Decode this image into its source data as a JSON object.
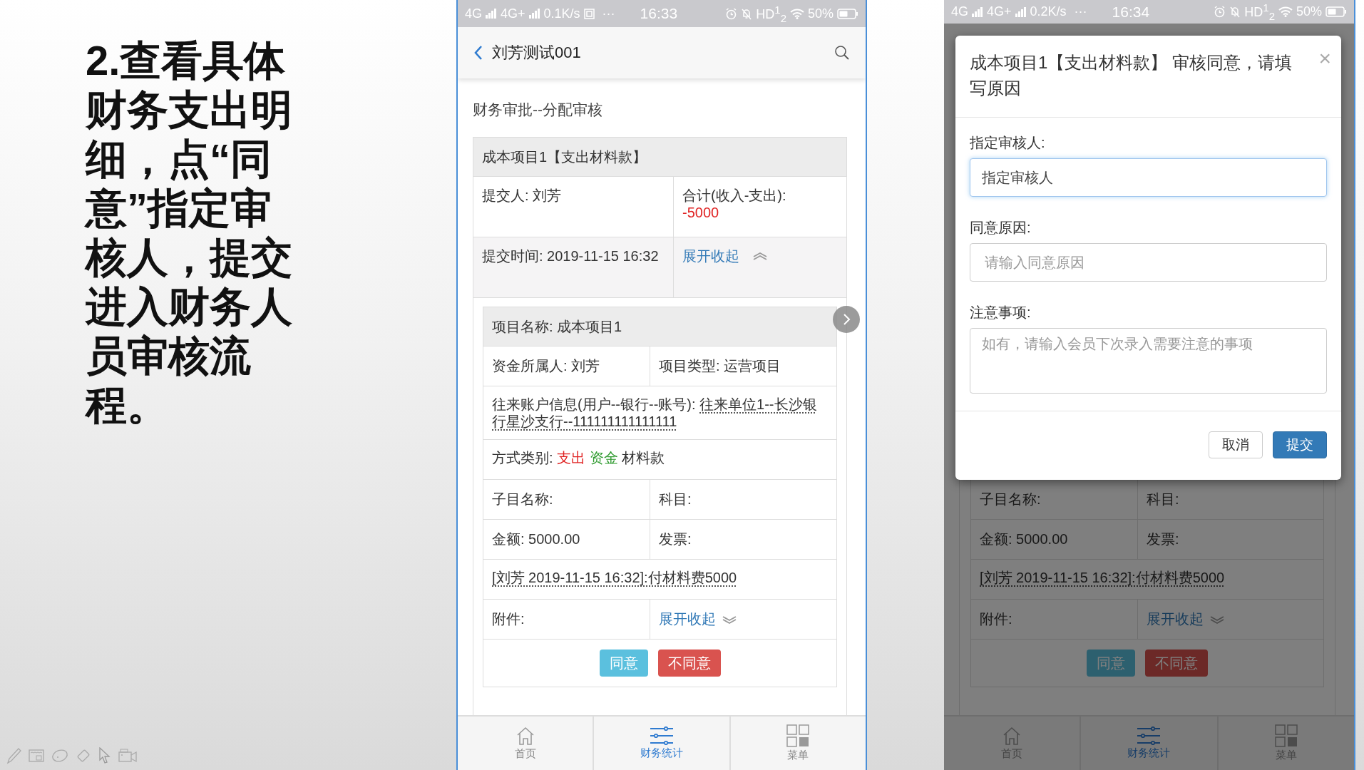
{
  "slide": {
    "instruction": "2.查看具体财务支出明细，点“同意”指定审核人，提交进入财务人员审核流程。"
  },
  "detail_screen": {
    "status_bar": {
      "network": "4G",
      "network2": "4G+",
      "speed": "0.1K/s",
      "sim_icon": true,
      "more": "···",
      "time": "16:33",
      "hd": "HD$^{1}$$_{2}$",
      "battery": "50%"
    },
    "header": {
      "title": "刘芳测试001"
    },
    "section_title": "财务审批--分配审核",
    "record": {
      "title": "成本项目1【支出材料款】",
      "submitter": "提交人: 刘芳",
      "total_label": "合计(收入-支出):",
      "total": "-5000",
      "time": "提交时间: 2019-11-15 16:32",
      "toggle": "展开收起",
      "expanded": true
    },
    "item": {
      "name": "项目名称: 成本项目1",
      "owner": "资金所属人: 刘芳",
      "type": "项目类型: 运营项目",
      "account_label": "往来账户信息(用户--银行--账号): ",
      "account": "往来单位1--长沙银行星沙支行--111111111111111",
      "method_label": "方式类别: ",
      "method_tags": [
        {
          "text": "支出",
          "color": "#e02424"
        },
        {
          "text": "资金",
          "color": "#2e9a2e"
        }
      ],
      "method_value": "材料款",
      "sub_name": "子目名称:",
      "subject": "科目:",
      "amount": "金额: 5000.00",
      "invoice": "发票:",
      "memo": "[刘芳 2019-11-15 16:32]:付材料费5000",
      "attachment": "附件:",
      "attachment_toggle": "展开收起",
      "attachment_expanded": false,
      "buttons": [
        {
          "label": "同意",
          "kind": "approve"
        },
        {
          "label": "不同意",
          "kind": "reject"
        }
      ]
    },
    "nav": [
      {
        "label": "首页",
        "kind": "home",
        "selected": false
      },
      {
        "label": "财务统计",
        "kind": "sliders",
        "selected": true
      },
      {
        "label": "菜单",
        "kind": "grid",
        "selected": false
      }
    ]
  },
  "dialog_screen": {
    "status_bar": {
      "network": "4G",
      "network2": "4G+",
      "speed": "0.2K/s",
      "sim_icon": false,
      "more": "···",
      "time": "16:34",
      "hd": "HD$^{1}$$_{2}$",
      "battery": "50%"
    },
    "dialog": {
      "title": "成本项目1【支出材料款】 审核同意，请填写原因",
      "close": "×",
      "fields": [
        {
          "label": "指定审核人:",
          "value": "指定审核人",
          "kind": "input",
          "focused": true
        },
        {
          "label": "同意原因:",
          "placeholder": "请输入同意原因",
          "kind": "input",
          "focused": false
        },
        {
          "label": "注意事项:",
          "placeholder": "如有，请输入会员下次录入需要注意的事项",
          "kind": "textarea",
          "focused": false
        }
      ],
      "buttons": [
        {
          "label": "取消",
          "kind": "default"
        },
        {
          "label": "提交",
          "kind": "primary"
        }
      ]
    },
    "item": {
      "sub_name": "子目名称:",
      "subject": "科目:",
      "amount": "金额: 5000.00",
      "invoice": "发票:",
      "memo": "[刘芳 2019-11-15 16:32]:付材料费5000",
      "attachment": "附件:",
      "attachment_toggle": "展开收起",
      "attachment_expanded": false,
      "buttons": [
        {
          "label": "同意",
          "kind": "approve"
        },
        {
          "label": "不同意",
          "kind": "reject"
        }
      ]
    },
    "nav": [
      {
        "label": "首页",
        "kind": "home",
        "selected": false
      },
      {
        "label": "财务统计",
        "kind": "sliders",
        "selected": true
      },
      {
        "label": "菜单",
        "kind": "grid",
        "selected": false
      }
    ]
  }
}
